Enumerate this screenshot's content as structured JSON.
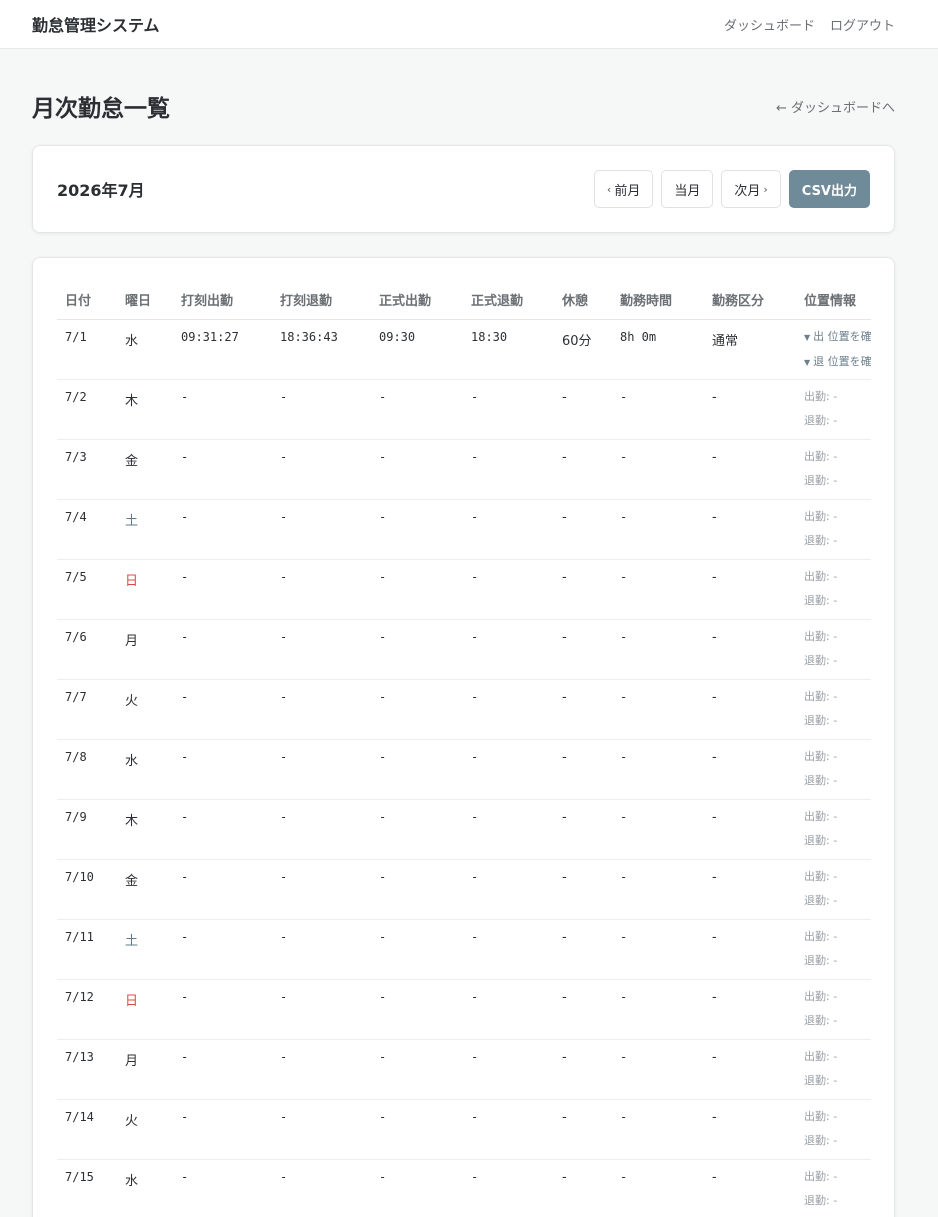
{
  "header": {
    "brand": "勤怠管理システム",
    "nav": [
      "ダッシュボード",
      "ログアウト"
    ]
  },
  "page": {
    "title": "月次勤怠一覧",
    "back_link": "← ダッシュボードへ"
  },
  "month_bar": {
    "label": "2026年7月",
    "prev": "前月",
    "current": "当月",
    "next": "次月",
    "csv": "CSV出力"
  },
  "colors": {
    "saturday": "#5e7a8a",
    "sunday": "#d94a4a",
    "primary_button": "#6f8a99"
  },
  "icons": {
    "prev": "chevron-left-icon",
    "next": "chevron-right-icon",
    "disclosure": "triangle-down-icon"
  },
  "table": {
    "columns": [
      "日付",
      "曜日",
      "打刻出勤",
      "打刻退勤",
      "正式出勤",
      "正式退勤",
      "休憩",
      "勤務時間",
      "勤務区分",
      "位置情報"
    ],
    "rows": [
      {
        "date": "7/1",
        "dow": "水",
        "type": "weekday",
        "punch_in": "09:31:27",
        "punch_out": "18:36:43",
        "in": "09:30",
        "out": "18:30",
        "break": "60分",
        "work": "8h 0m",
        "category": "通常",
        "loc_in": "出 位置を確",
        "loc_out": "退 位置を確",
        "has_loc": true
      },
      {
        "date": "7/2",
        "dow": "木",
        "type": "weekday",
        "punch_in": "-",
        "punch_out": "-",
        "in": "-",
        "out": "-",
        "break": "-",
        "work": "-",
        "category": "-",
        "loc_in": "出勤: -",
        "loc_out": "退勤: -",
        "has_loc": false
      },
      {
        "date": "7/3",
        "dow": "金",
        "type": "weekday",
        "punch_in": "-",
        "punch_out": "-",
        "in": "-",
        "out": "-",
        "break": "-",
        "work": "-",
        "category": "-",
        "loc_in": "出勤: -",
        "loc_out": "退勤: -",
        "has_loc": false
      },
      {
        "date": "7/4",
        "dow": "土",
        "type": "saturday",
        "punch_in": "-",
        "punch_out": "-",
        "in": "-",
        "out": "-",
        "break": "-",
        "work": "-",
        "category": "-",
        "loc_in": "出勤: -",
        "loc_out": "退勤: -",
        "has_loc": false
      },
      {
        "date": "7/5",
        "dow": "日",
        "type": "sunday",
        "punch_in": "-",
        "punch_out": "-",
        "in": "-",
        "out": "-",
        "break": "-",
        "work": "-",
        "category": "-",
        "loc_in": "出勤: -",
        "loc_out": "退勤: -",
        "has_loc": false
      },
      {
        "date": "7/6",
        "dow": "月",
        "type": "weekday",
        "punch_in": "-",
        "punch_out": "-",
        "in": "-",
        "out": "-",
        "break": "-",
        "work": "-",
        "category": "-",
        "loc_in": "出勤: -",
        "loc_out": "退勤: -",
        "has_loc": false
      },
      {
        "date": "7/7",
        "dow": "火",
        "type": "weekday",
        "punch_in": "-",
        "punch_out": "-",
        "in": "-",
        "out": "-",
        "break": "-",
        "work": "-",
        "category": "-",
        "loc_in": "出勤: -",
        "loc_out": "退勤: -",
        "has_loc": false
      },
      {
        "date": "7/8",
        "dow": "水",
        "type": "weekday",
        "punch_in": "-",
        "punch_out": "-",
        "in": "-",
        "out": "-",
        "break": "-",
        "work": "-",
        "category": "-",
        "loc_in": "出勤: -",
        "loc_out": "退勤: -",
        "has_loc": false
      },
      {
        "date": "7/9",
        "dow": "木",
        "type": "weekday",
        "punch_in": "-",
        "punch_out": "-",
        "in": "-",
        "out": "-",
        "break": "-",
        "work": "-",
        "category": "-",
        "loc_in": "出勤: -",
        "loc_out": "退勤: -",
        "has_loc": false
      },
      {
        "date": "7/10",
        "dow": "金",
        "type": "weekday",
        "punch_in": "-",
        "punch_out": "-",
        "in": "-",
        "out": "-",
        "break": "-",
        "work": "-",
        "category": "-",
        "loc_in": "出勤: -",
        "loc_out": "退勤: -",
        "has_loc": false
      },
      {
        "date": "7/11",
        "dow": "土",
        "type": "saturday",
        "punch_in": "-",
        "punch_out": "-",
        "in": "-",
        "out": "-",
        "break": "-",
        "work": "-",
        "category": "-",
        "loc_in": "出勤: -",
        "loc_out": "退勤: -",
        "has_loc": false
      },
      {
        "date": "7/12",
        "dow": "日",
        "type": "sunday",
        "punch_in": "-",
        "punch_out": "-",
        "in": "-",
        "out": "-",
        "break": "-",
        "work": "-",
        "category": "-",
        "loc_in": "出勤: -",
        "loc_out": "退勤: -",
        "has_loc": false
      },
      {
        "date": "7/13",
        "dow": "月",
        "type": "weekday",
        "punch_in": "-",
        "punch_out": "-",
        "in": "-",
        "out": "-",
        "break": "-",
        "work": "-",
        "category": "-",
        "loc_in": "出勤: -",
        "loc_out": "退勤: -",
        "has_loc": false
      },
      {
        "date": "7/14",
        "dow": "火",
        "type": "weekday",
        "punch_in": "-",
        "punch_out": "-",
        "in": "-",
        "out": "-",
        "break": "-",
        "work": "-",
        "category": "-",
        "loc_in": "出勤: -",
        "loc_out": "退勤: -",
        "has_loc": false
      },
      {
        "date": "7/15",
        "dow": "水",
        "type": "weekday",
        "punch_in": "-",
        "punch_out": "-",
        "in": "-",
        "out": "-",
        "break": "-",
        "work": "-",
        "category": "-",
        "loc_in": "出勤: -",
        "loc_out": "退勤: -",
        "has_loc": false
      }
    ]
  }
}
